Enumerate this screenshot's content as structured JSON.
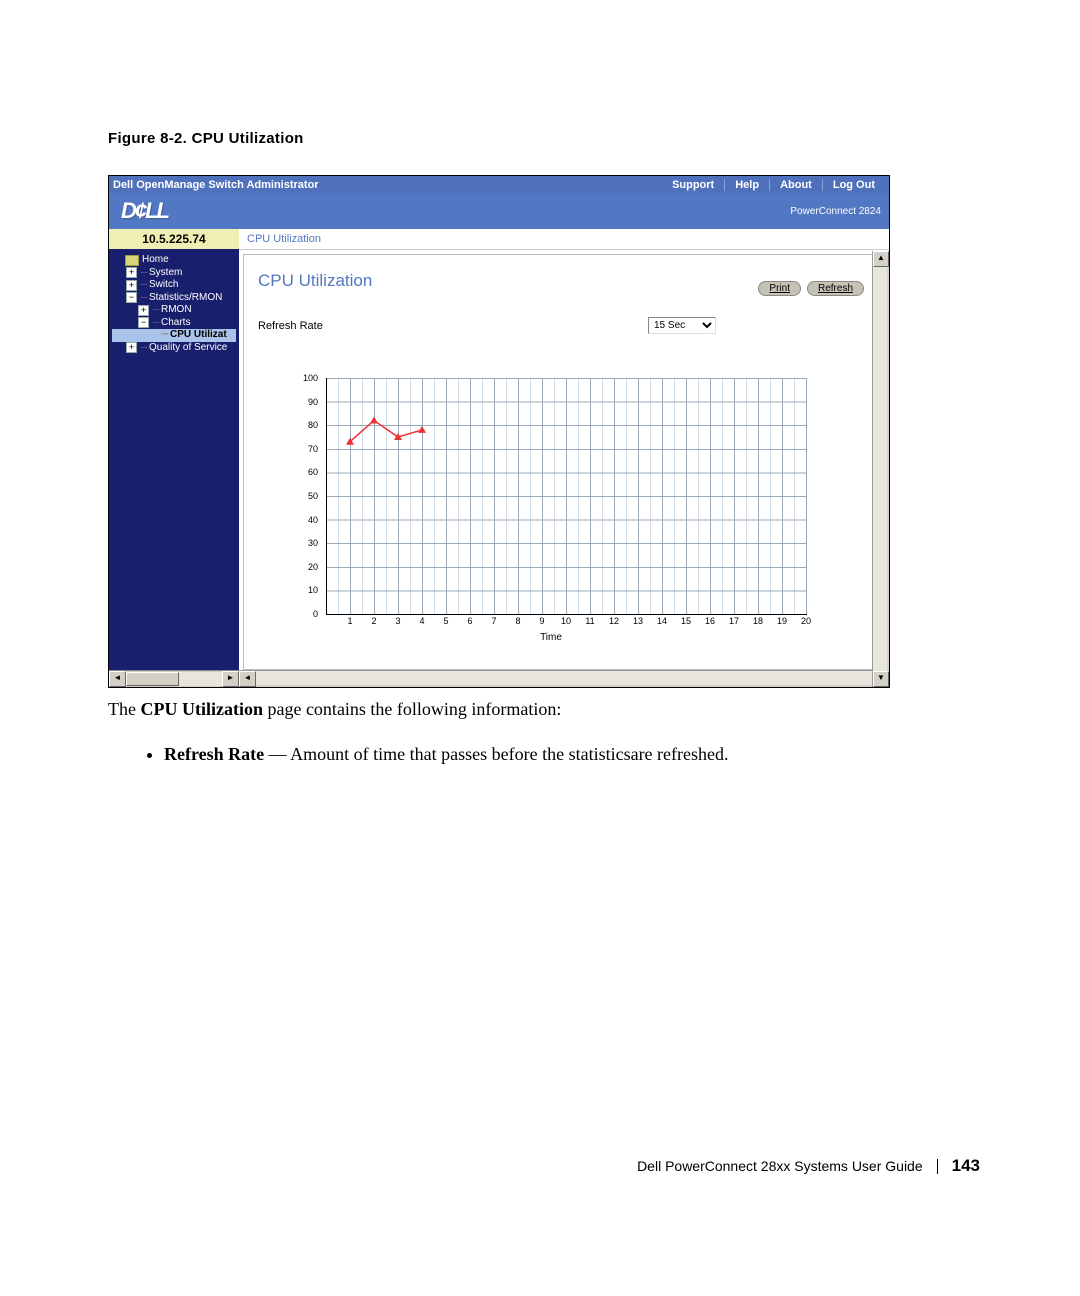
{
  "figure_caption": "Figure 8-2.    CPU Utilization",
  "titlebar": {
    "app_title": "Dell OpenManage Switch Administrator",
    "links": [
      "Support",
      "Help",
      "About",
      "Log Out"
    ]
  },
  "brand": {
    "logo_text": "D¢LL",
    "product": "PowerConnect 2824"
  },
  "sidebar": {
    "ip": "10.5.225.74",
    "items": [
      {
        "expander": "",
        "icon": "folder",
        "label": "Home",
        "indent": 0
      },
      {
        "expander": "+",
        "icon": "",
        "label": "System",
        "indent": 1
      },
      {
        "expander": "+",
        "icon": "",
        "label": "Switch",
        "indent": 1
      },
      {
        "expander": "−",
        "icon": "",
        "label": "Statistics/RMON",
        "indent": 1
      },
      {
        "expander": "+",
        "icon": "",
        "label": "RMON",
        "indent": 2
      },
      {
        "expander": "−",
        "icon": "",
        "label": "Charts",
        "indent": 2
      },
      {
        "expander": "",
        "icon": "",
        "label": "CPU Utilizat",
        "indent": 3,
        "selected": true
      },
      {
        "expander": "+",
        "icon": "",
        "label": "Quality of Service",
        "indent": 1
      }
    ]
  },
  "main": {
    "breadcrumb": "CPU Utilization",
    "panel_title": "CPU Utilization",
    "print_label": "Print",
    "refresh_btn_label": "Refresh",
    "refresh_rate_label": "Refresh Rate",
    "refresh_rate_value": "15 Sec",
    "x_axis_label": "Time"
  },
  "chart_data": {
    "type": "line",
    "xlabel": "Time",
    "ylabel": "",
    "ylim": [
      0,
      100
    ],
    "xlim": [
      0,
      20
    ],
    "x_ticks": [
      1,
      2,
      3,
      4,
      5,
      6,
      7,
      8,
      9,
      10,
      11,
      12,
      13,
      14,
      15,
      16,
      17,
      18,
      19,
      20
    ],
    "y_ticks": [
      0,
      10,
      20,
      30,
      40,
      50,
      60,
      70,
      80,
      90,
      100
    ],
    "series": [
      {
        "name": "CPU",
        "color": "#e33",
        "x": [
          1,
          2,
          3,
          4
        ],
        "values": [
          73,
          82,
          75,
          78
        ]
      }
    ]
  },
  "doc_text": {
    "sentence_prefix": "The ",
    "sentence_bold": "CPU Utilization",
    "sentence_suffix": " page contains the following information:",
    "bullet_bold": "Refresh Rate",
    "bullet_rest": " — Amount of time that passes before the statisticsare refreshed."
  },
  "footer": {
    "guide": "Dell PowerConnect 28xx Systems User Guide",
    "page": "143"
  }
}
